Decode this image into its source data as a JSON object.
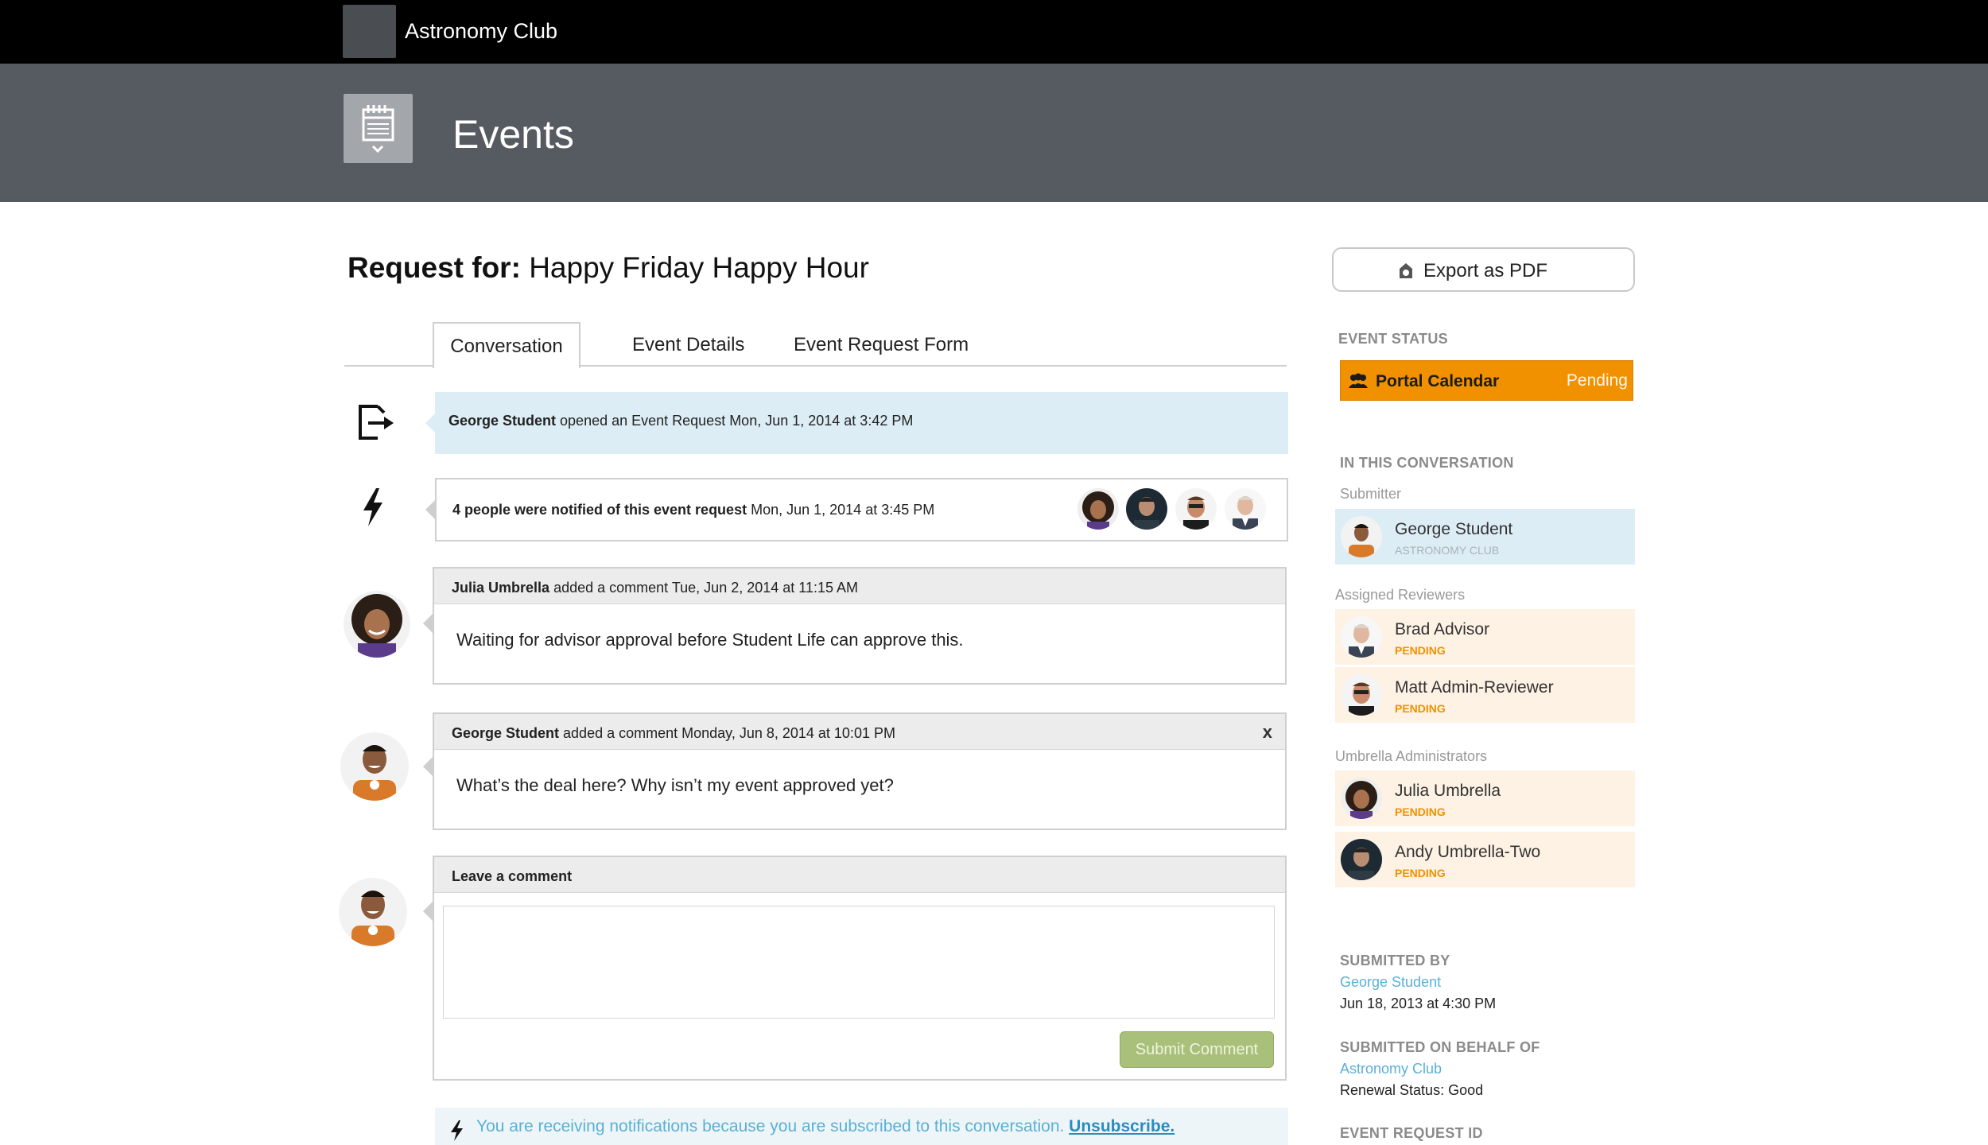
{
  "app": {
    "org_name": "Astronomy Club",
    "module_title": "Events"
  },
  "request": {
    "label": "Request for:",
    "title": "Happy Friday Happy Hour"
  },
  "tabs": [
    {
      "label": "Conversation",
      "active": true
    },
    {
      "label": "Event Details",
      "active": false
    },
    {
      "label": "Event Request Form",
      "active": false
    }
  ],
  "timeline": {
    "opened": {
      "actor": "George Student",
      "text": "opened an Event Request Mon, Jun 1, 2014 at 3:42 PM"
    },
    "notified": {
      "strong": "4 people were notified of this event request",
      "text": "Mon, Jun 1, 2014 at 3:45 PM"
    },
    "comments": [
      {
        "author": "Julia Umbrella",
        "meta": "added a comment Tue, Jun 2, 2014 at 11:15 AM",
        "body": "Waiting for advisor approval before Student Life can approve this."
      },
      {
        "author": "George Student",
        "meta": "added a comment Monday, Jun 8, 2014 at 10:01 PM",
        "body": "What’s the deal here? Why isn’t my event approved yet?",
        "close": "x"
      }
    ],
    "leave_comment": {
      "label": "Leave a comment",
      "submit": "Submit Comment"
    },
    "notice": {
      "text": "You are receiving notifications because you are subscribed to this conversation.",
      "link": "Unsubscribe."
    }
  },
  "sidebar": {
    "export_label": "Export as PDF",
    "event_status_label": "EVENT STATUS",
    "status": {
      "name": "Portal Calendar",
      "state": "Pending",
      "color": "#f29100"
    },
    "in_conversation_label": "IN THIS CONVERSATION",
    "submitter_label": "Submitter",
    "submitter": {
      "name": "George Student",
      "org": "ASTRONOMY CLUB"
    },
    "reviewers_label": "Assigned Reviewers",
    "reviewers": [
      {
        "name": "Brad Advisor",
        "status": "PENDING"
      },
      {
        "name": "Matt Admin-Reviewer",
        "status": "PENDING"
      }
    ],
    "admins_label": "Umbrella Administrators",
    "admins": [
      {
        "name": "Julia Umbrella",
        "status": "PENDING"
      },
      {
        "name": "Andy Umbrella-Two",
        "status": "PENDING"
      }
    ],
    "submitted_by_label": "SUBMITTED BY",
    "submitted_by": {
      "name": "George Student",
      "date": "Jun 18, 2013 at 4:30 PM"
    },
    "behalf_label": "SUBMITTED ON BEHALF OF",
    "behalf": {
      "org": "Astronomy Club",
      "renewal": "Renewal Status: Good"
    },
    "request_id_label": "EVENT REQUEST ID"
  }
}
